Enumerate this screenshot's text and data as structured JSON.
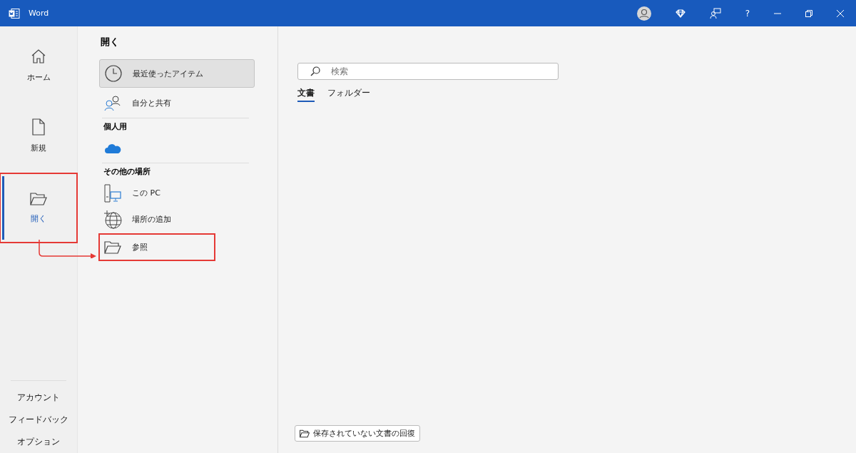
{
  "window": {
    "title": "Word",
    "help_button": "?"
  },
  "nav": [
    {
      "kind": "home",
      "label": "ホーム",
      "selected": false,
      "annotated": false
    },
    {
      "kind": "new",
      "label": "新規",
      "selected": false,
      "annotated": false
    },
    {
      "kind": "open",
      "label": "開く",
      "selected": true,
      "annotated": true
    }
  ],
  "nav_bottom": [
    {
      "label": "アカウント"
    },
    {
      "label": "フィードバック"
    },
    {
      "label": "オプション"
    }
  ],
  "heading": "開く",
  "locations": [
    {
      "kind": "clock",
      "label": "最近使ったアイテム",
      "selected": true,
      "annotated": false
    },
    {
      "kind": "people",
      "label": "自分と共有",
      "selected": false,
      "annotated": false
    },
    {
      "kind": "section",
      "label": "個人用"
    },
    {
      "kind": "cloud",
      "selected": false,
      "annotated": false
    },
    {
      "kind": "section",
      "label": "その他の場所"
    },
    {
      "kind": "pc",
      "label": "この PC",
      "selected": false,
      "annotated": false
    },
    {
      "kind": "globe",
      "label": "場所の追加",
      "selected": false,
      "annotated": false
    },
    {
      "kind": "folder",
      "label": "参照",
      "selected": false,
      "annotated": true
    }
  ],
  "search": {
    "placeholder": "検索"
  },
  "tabs": [
    {
      "label": "文書",
      "selected": true
    },
    {
      "label": "フォルダー",
      "selected": false
    }
  ],
  "recover_button": "保存されていない文書の回復"
}
